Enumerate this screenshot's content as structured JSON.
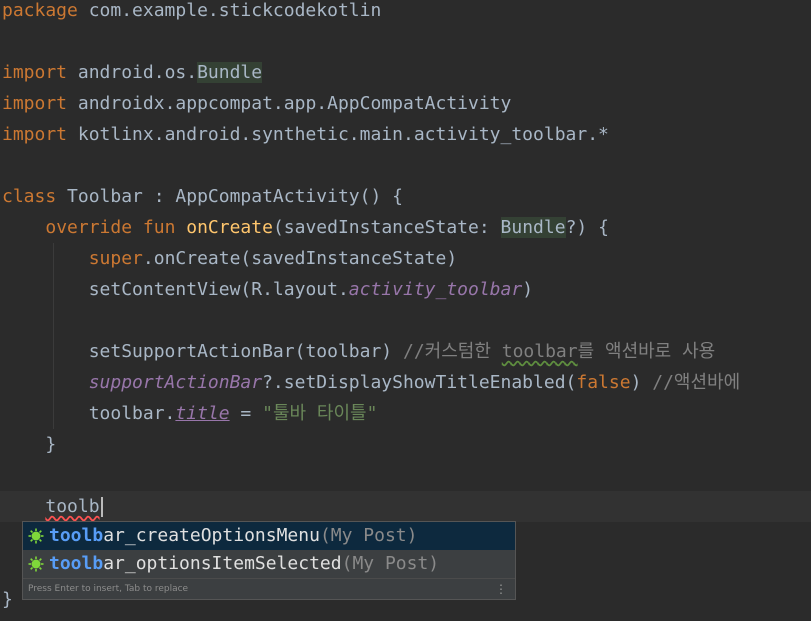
{
  "code": {
    "line1": {
      "kw": "package",
      "rest": " com.example.stickcodekotlin"
    },
    "line2": {
      "kw": "import",
      "pre": " android.os.",
      "hl": "Bundle"
    },
    "line3": {
      "kw": "import",
      "rest": " androidx.appcompat.app.AppCompatActivity"
    },
    "line4": {
      "kw": "import",
      "rest": " kotlinx.android.synthetic.main.activity_toolbar.*"
    },
    "line5": {
      "kw": "class",
      "rest": " Toolbar : AppCompatActivity() {"
    },
    "line6": {
      "indent": "    ",
      "kw": "override fun",
      "sp": " ",
      "fn": "onCreate",
      "pre": "(savedInstanceState: ",
      "hl": "Bundle",
      "post": "?) {"
    },
    "line7": {
      "indent": "        ",
      "kw": "super",
      "rest": ".onCreate(savedInstanceState)"
    },
    "line8": {
      "indent": "        ",
      "pre": "setContentView(R.layout.",
      "it": "activity_toolbar",
      "post": ")"
    },
    "line9": {
      "indent": "        ",
      "pre": "setSupportActionBar(toolbar) ",
      "cm1": "//커스텀한 ",
      "cmul": "toolbar",
      "cm2": "를 액션바로 사용"
    },
    "line10": {
      "indent": "        ",
      "it": "supportActionBar",
      "pre": "?.setDisplayShowTitleEnabled(",
      "kw": "false",
      "post": ") ",
      "cm": "//액션바에"
    },
    "line11": {
      "indent": "        ",
      "pre": "toolbar.",
      "itul": "title",
      "mid": " = ",
      "st": "\"툴바 타이틀\""
    },
    "line12": {
      "indent": "    ",
      "text": "}"
    },
    "line13": {
      "indent": "    ",
      "typed": "toolb"
    },
    "line14": {
      "text": "}"
    }
  },
  "autocomplete": {
    "items": [
      {
        "match": "toolb",
        "rest": "ar_createOptionsMenu",
        "context": "(My Post)",
        "icon": "method-icon"
      },
      {
        "match": "toolb",
        "rest": "ar_optionsItemSelected",
        "context": "(My Post)",
        "icon": "method-icon"
      }
    ],
    "footer": "Press Enter to insert, Tab to replace",
    "menu": "⋮"
  },
  "colors": {
    "background": "#2b2b2b",
    "keyword": "#cc7832",
    "function": "#ffc66d",
    "string": "#6a8759",
    "comment": "#808080",
    "property": "#9876aa",
    "match": "#589df6"
  }
}
